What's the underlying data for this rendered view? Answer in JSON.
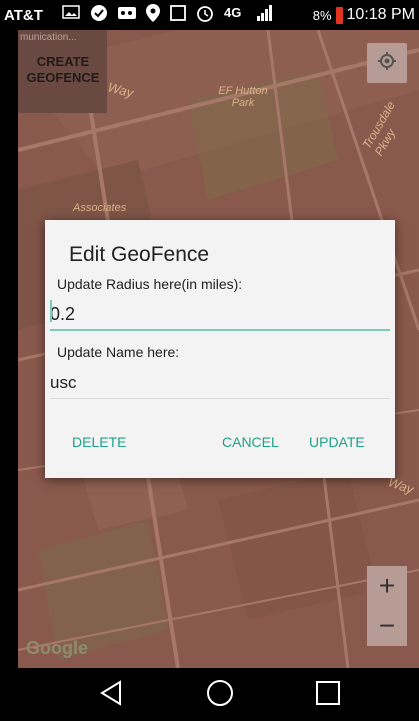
{
  "status_bar": {
    "carrier": "AT&T",
    "battery_percent": "8%",
    "time": "10:18 PM",
    "icons": [
      "image-icon",
      "shield-icon",
      "voicemail-icon",
      "location-icon",
      "nfc-icon",
      "alarm-icon",
      "lte-icon",
      "signal-icon",
      "battery-icon"
    ],
    "battery_color": "#e0351f"
  },
  "map": {
    "labels": [
      "EF Hutton Park",
      "Associates",
      "Trousdale Pkwy",
      "an Way",
      "Way"
    ],
    "attribution": "Google"
  },
  "geofence_button": {
    "truncated_text": "munication...",
    "label": "CREATE GEOFENCE"
  },
  "dialog": {
    "title": "Edit GeoFence",
    "radius_label": "Update Radius here(in miles):",
    "radius_value": "0.2",
    "name_label": "Update Name here:",
    "name_value": "usc",
    "delete_label": "DELETE",
    "cancel_label": "CANCEL",
    "update_label": "UPDATE",
    "accent_color": "#1fa187",
    "underline_color": "#79cbb8"
  },
  "zoom": {
    "in_label": "+",
    "out_label": "−"
  }
}
